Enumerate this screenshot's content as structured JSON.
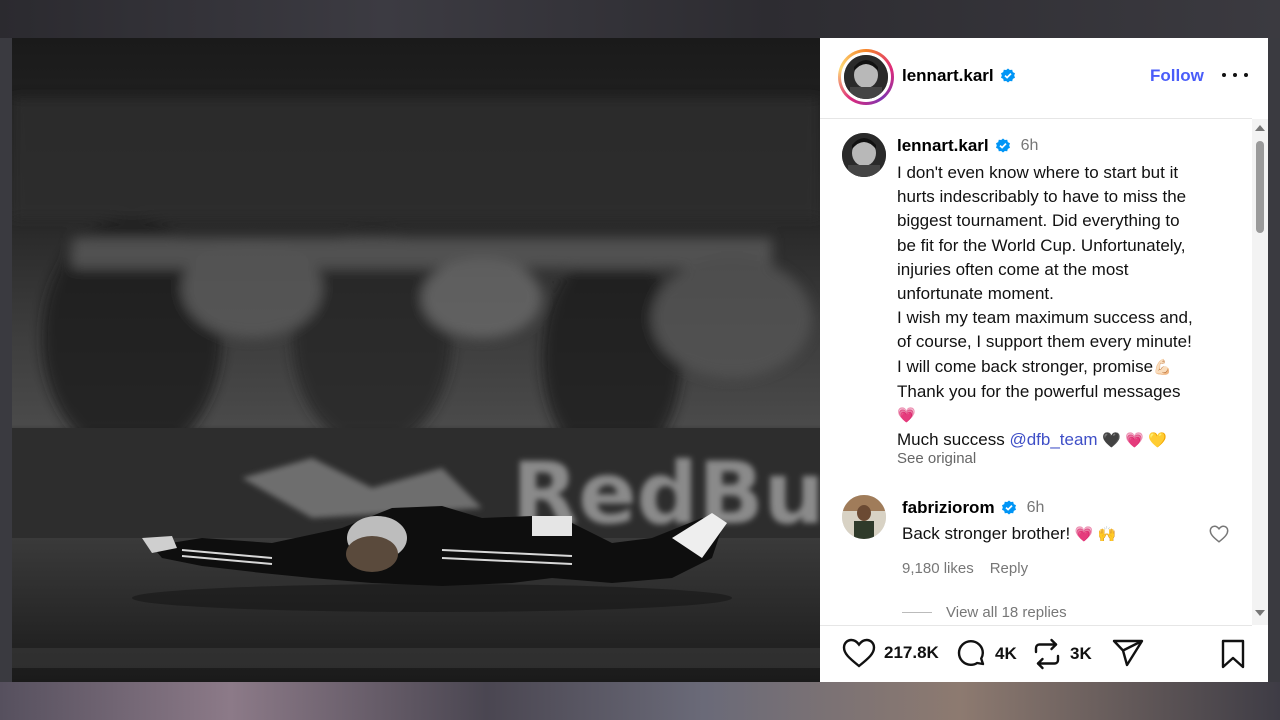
{
  "post": {
    "username": "lennart.karl",
    "follow_label": "Follow"
  },
  "caption": {
    "username": "lennart.karl",
    "time": "6h",
    "lines": [
      "I don't even know where to start but it",
      "hurts indescribably to have to miss the",
      "biggest tournament. Did everything to",
      "be fit for the World Cup. Unfortunately,",
      "injuries often come at the most",
      "unfortunate moment.",
      "I wish my team maximum success and,",
      "of course, I support them every minute!",
      "I will come back stronger, promise",
      "Thank you for the powerful messages"
    ],
    "muscle_emoji": "💪🏻",
    "heart_emoji": "💗",
    "last_line_prefix": "Much success ",
    "mention": "@dfb_team",
    "last_line_emojis": "🖤 💗 💛",
    "see_original": "See original"
  },
  "comment": {
    "username": "fabriziorom",
    "time": "6h",
    "text": "Back stronger brother! ",
    "emojis": "💗 🙌",
    "likes": "9,180 likes",
    "reply_label": "Reply",
    "view_replies": "View all 18 replies"
  },
  "actions": {
    "likes": "217.8K",
    "comments": "4K",
    "reposts": "3K"
  },
  "photo": {
    "sign_text": "RedBull"
  },
  "colors": {
    "follow": "#4a5df9",
    "mention": "#3f4fc7",
    "verified": "#0095f6"
  },
  "icons": [
    "verified-badge-icon",
    "more-options-icon",
    "heart-icon",
    "comment-icon",
    "repost-icon",
    "share-icon",
    "bookmark-icon"
  ]
}
